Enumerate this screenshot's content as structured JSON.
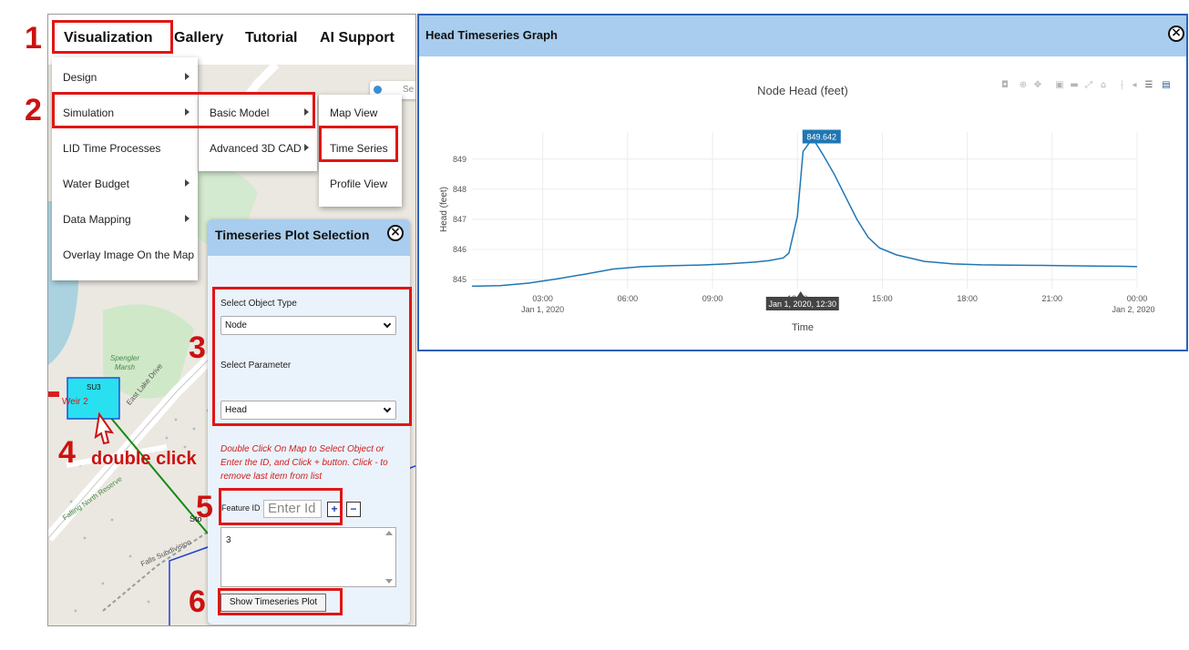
{
  "navbar": {
    "items": [
      "Visualization",
      "Gallery",
      "Tutorial",
      "AI Support"
    ]
  },
  "menu": {
    "items": [
      "Design",
      "Simulation",
      "LID Time Processes",
      "Water Budget",
      "Data Mapping",
      "Overlay Image On the Map"
    ],
    "submenu": [
      "Basic Model",
      "Advanced 3D CAD"
    ],
    "submenu2": [
      "Map View",
      "Time Series",
      "Profile View"
    ]
  },
  "map": {
    "search_placeholder": "Se",
    "labels": {
      "su3": "SU3",
      "weir": "Weir 2",
      "marsh": "Spengler Marsh",
      "road1": "East Lake Drive",
      "road2": "Falls Subdivision",
      "road3": "Falling North Reserve",
      "sto": "Sto"
    }
  },
  "panel": {
    "title": "Timeseries Plot Selection",
    "object_type_label": "Select Object Type",
    "object_type_value": "Node",
    "parameter_label": "Select Parameter",
    "parameter_value": "Head",
    "hint": "Double Click On Map to Select Object or Enter the ID, and Click + button. Click - to remove last item from list",
    "feature_label": "Feature ID",
    "feature_placeholder": "Enter Id",
    "plus": "+",
    "minus": "−",
    "list_value": "3",
    "show_button": "Show Timeseries Plot"
  },
  "annotations": {
    "steps": [
      "1",
      "2",
      "3",
      "4",
      "5",
      "6"
    ],
    "double_click": "double click"
  },
  "graph": {
    "window_title": "Head Timeseries Graph"
  },
  "colors": {
    "annotation_red": "#e01616",
    "header_blue": "#a9cdee",
    "line_blue": "#1f77b4",
    "su3_fill": "#29e0f0"
  },
  "chart_data": {
    "type": "line",
    "title": "Node Head (feet)",
    "xlabel": "Time",
    "ylabel": "Head (feet)",
    "x_ticks": [
      "03:00",
      "06:00",
      "09:00",
      "12:00",
      "15:00",
      "18:00",
      "21:00",
      "00:00"
    ],
    "x_tick_sub": {
      "first": "Jan 1, 2020",
      "last": "Jan 2, 2020"
    },
    "x_range_hours": [
      0.5,
      24
    ],
    "y_ticks": [
      845,
      846,
      847,
      848,
      849
    ],
    "ylim": [
      844.7,
      849.9
    ],
    "grid": true,
    "series": [
      {
        "x": [
          0.5,
          1.5,
          2.5,
          3.5,
          4.5,
          5.5,
          6.5,
          7.5,
          8.5,
          9.5,
          10.5,
          11.0,
          11.5,
          11.7,
          12.0,
          12.2,
          12.4,
          12.5,
          12.6,
          12.9,
          13.3,
          13.7,
          14.1,
          14.5,
          14.9,
          15.5,
          16.5,
          17.5,
          18.5,
          19.5,
          20.5,
          21.5,
          22.5,
          23.5,
          24.0
        ],
        "y": [
          844.78,
          844.8,
          844.88,
          845.02,
          845.18,
          845.35,
          845.43,
          845.46,
          845.48,
          845.52,
          845.58,
          845.63,
          845.72,
          845.88,
          847.1,
          849.25,
          849.52,
          849.642,
          849.6,
          849.15,
          848.5,
          847.75,
          847.0,
          846.4,
          846.05,
          845.82,
          845.6,
          845.52,
          845.49,
          845.48,
          845.47,
          845.46,
          845.45,
          845.44,
          845.43
        ]
      }
    ],
    "hover": {
      "value_label": "849.642",
      "x_label": "Jan 1, 2020, 12:30"
    }
  }
}
